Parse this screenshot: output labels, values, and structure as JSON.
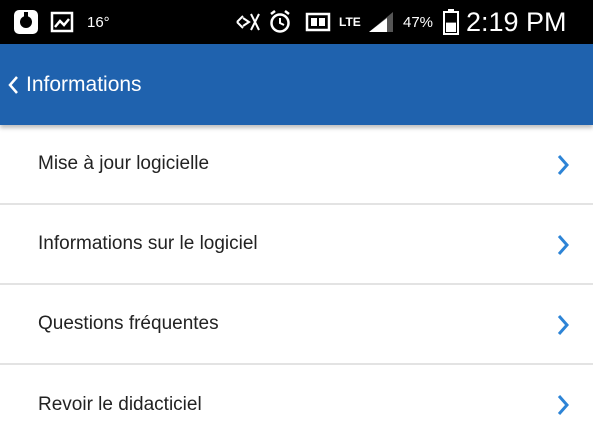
{
  "status_bar": {
    "temperature": "16°",
    "network": "LTE",
    "battery_percent": "47%",
    "battery_level": 0.47,
    "time": "2:19 PM",
    "icons": [
      "app-icon",
      "gallery-icon",
      "mute-icon",
      "alarm-icon",
      "data-icon",
      "lte-icon",
      "signal-icon",
      "battery-icon"
    ]
  },
  "header": {
    "title": "Informations",
    "back_icon": "chevron-left-icon",
    "background": "#1f62ae"
  },
  "menu": {
    "items": [
      {
        "label": "Mise à jour logicielle"
      },
      {
        "label": "Informations sur le logiciel"
      },
      {
        "label": "Questions fréquentes"
      },
      {
        "label": "Revoir le didacticiel"
      }
    ],
    "chevron_icon": "chevron-right-icon",
    "accent": "#2d84d6"
  }
}
